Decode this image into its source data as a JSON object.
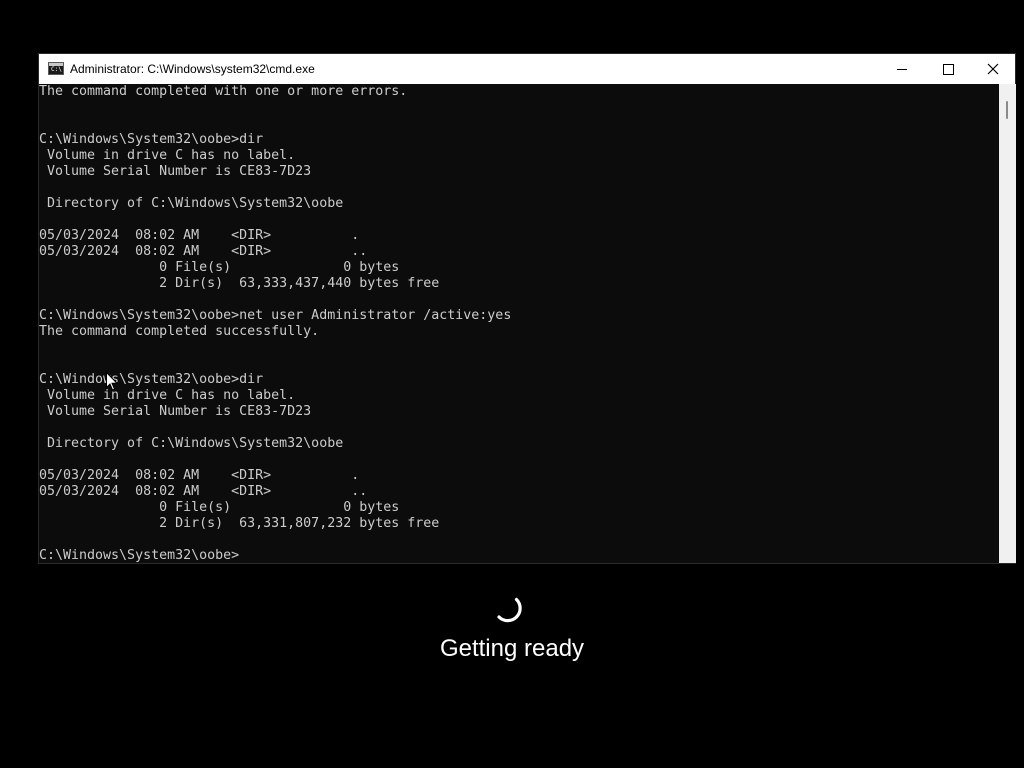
{
  "window": {
    "title": "Administrator: C:\\Windows\\system32\\cmd.exe",
    "icon_label": "C:\\",
    "buttons": {
      "minimize": "minimize-icon",
      "maximize": "maximize-icon",
      "close": "close-icon"
    }
  },
  "console": {
    "lines": [
      "The command completed with one or more errors.",
      "",
      "",
      "C:\\Windows\\System32\\oobe>dir",
      " Volume in drive C has no label.",
      " Volume Serial Number is CE83-7D23",
      "",
      " Directory of C:\\Windows\\System32\\oobe",
      "",
      "05/03/2024  08:02 AM    <DIR>          .",
      "05/03/2024  08:02 AM    <DIR>          ..",
      "               0 File(s)              0 bytes",
      "               2 Dir(s)  63,333,437,440 bytes free",
      "",
      "C:\\Windows\\System32\\oobe>net user Administrator /active:yes",
      "The command completed successfully.",
      "",
      "",
      "C:\\Windows\\System32\\oobe>dir",
      " Volume in drive C has no label.",
      " Volume Serial Number is CE83-7D23",
      "",
      " Directory of C:\\Windows\\System32\\oobe",
      "",
      "05/03/2024  08:02 AM    <DIR>          .",
      "05/03/2024  08:02 AM    <DIR>          ..",
      "               0 File(s)              0 bytes",
      "               2 Dir(s)  63,331,807,232 bytes free",
      "",
      "C:\\Windows\\System32\\oobe>"
    ]
  },
  "setup": {
    "status": "Getting ready",
    "spinner_icon": "loading-spinner-icon"
  },
  "colors": {
    "console_bg": "#0c0c0c",
    "console_text": "#cccccc",
    "titlebar_bg": "#ffffff",
    "desktop_bg": "#000000"
  }
}
